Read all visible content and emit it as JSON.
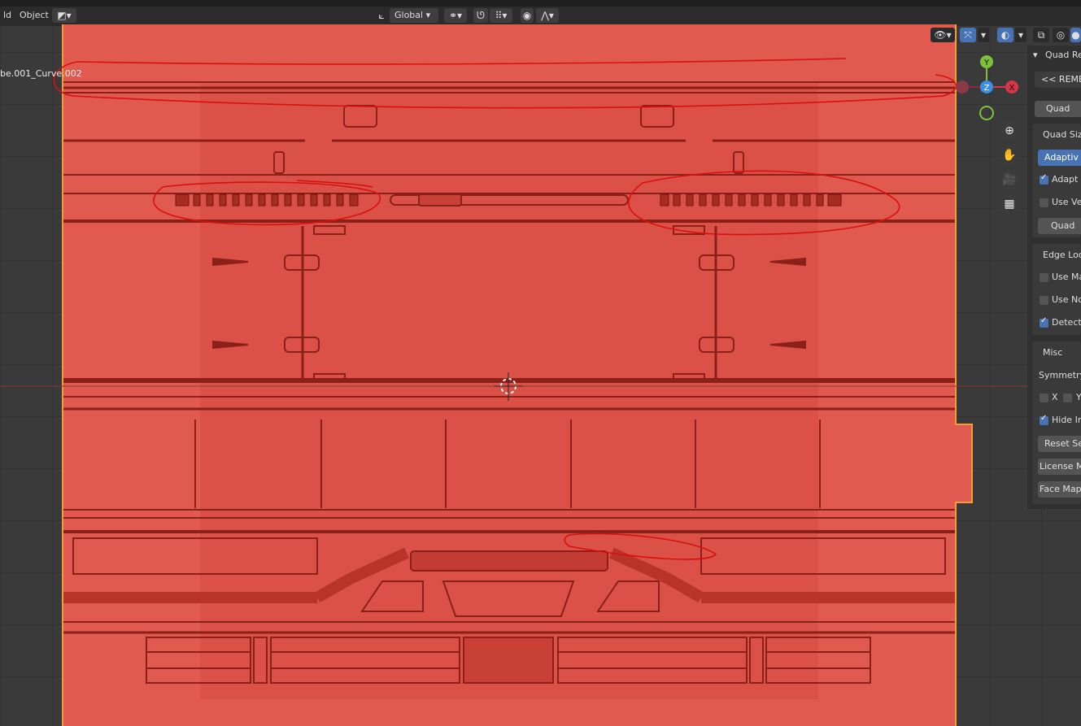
{
  "header": {
    "mode_left": "ld",
    "menu_object": "Object",
    "transform_orientation": "Global"
  },
  "viewport": {
    "object_name": "be.001_Curve.002",
    "gizmo": {
      "x": "X",
      "y": "Y",
      "z": "Z"
    },
    "nav_icons": [
      "zoom-icon",
      "hand-pan-icon",
      "camera-icon",
      "grid-icon"
    ]
  },
  "npanel": {
    "title": "Quad Re",
    "remesh_button": "<< REMES",
    "mode_button": "Quad",
    "quad_size_label": "Quad Size",
    "adaptive_button": "Adaptiv",
    "adapt_check": "Adapt Q",
    "use_vert_check": "Use Ve",
    "quad_button2": "Quad",
    "edge_loops_label": "Edge Loo",
    "use_mat_check": "Use Ma",
    "use_normals_check": "Use No",
    "detect_check": "Detect",
    "misc_label": "Misc",
    "symmetry_label": "Symmetry",
    "sym_x": "X",
    "sym_y": "Y",
    "hide_input_check": "Hide In",
    "reset_button": "Reset Se",
    "license_button": "License M",
    "face_maps_button": "Face Maps",
    "checks": {
      "adapt": true,
      "use_vert": false,
      "use_mat": false,
      "use_normals": false,
      "detect": true,
      "sym_x": false,
      "sym_y": false,
      "hide_input": true
    }
  },
  "colors": {
    "mesh": "#e05a50",
    "selection_outline": "#f0a030",
    "annotation": "#d81010",
    "accent": "#4772b3"
  }
}
